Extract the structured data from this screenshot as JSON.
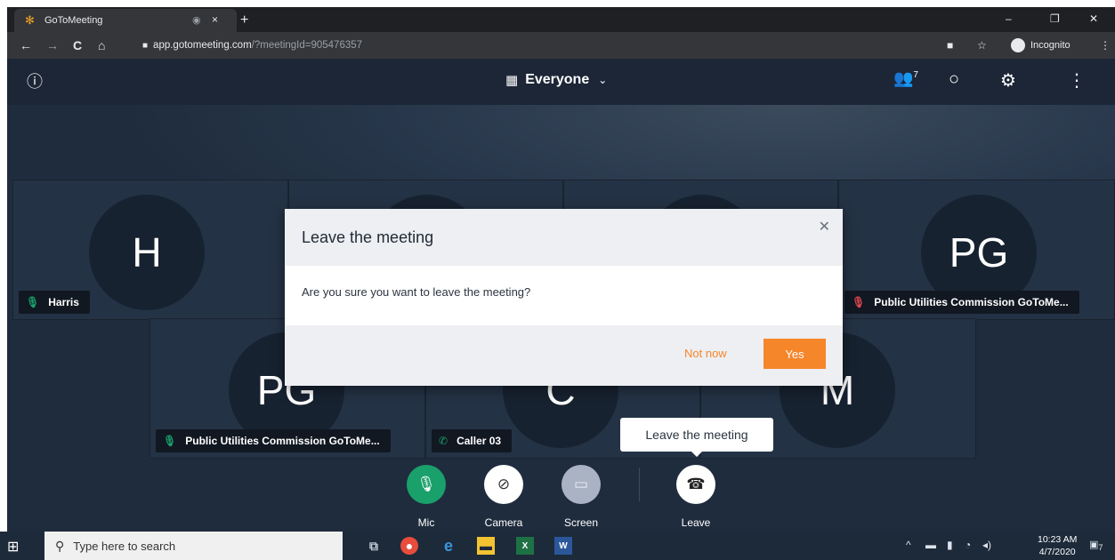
{
  "browser": {
    "tab_title": "GoToMeeting",
    "tab_close": "×",
    "new_tab": "+",
    "url_host": "app.gotomeeting.com",
    "url_rest": "/?meetingId=905476357",
    "incognito_label": "Incognito",
    "back": "←",
    "forward": "→",
    "reload": "C",
    "home": "⌂",
    "window_min": "–",
    "window_restore": "❐",
    "window_close": "✕"
  },
  "app": {
    "view_label": "Everyone",
    "participants_count": "7",
    "tiles": [
      {
        "initials": "H",
        "name": "Harris",
        "icon": "mic-icon"
      },
      {
        "initials": "PG",
        "name": "Public Utilities Commission GoToMe...",
        "icon": "mic-muted-icon"
      },
      {
        "initials": "PG",
        "name": "Public Utilities Commission GoToMe...",
        "icon": "mic-icon"
      },
      {
        "initials": "C",
        "name": "Caller 03",
        "icon": "phone-icon"
      },
      {
        "initials": "M",
        "name": "",
        "icon": ""
      }
    ]
  },
  "modal": {
    "title": "Leave the meeting",
    "message": "Are you sure you want to leave the meeting?",
    "not_now": "Not now",
    "yes": "Yes"
  },
  "tooltip": "Leave the meeting",
  "controls": {
    "mic": "Mic",
    "camera": "Camera",
    "screen": "Screen",
    "leave": "Leave"
  },
  "taskbar": {
    "search_placeholder": "Type here to search",
    "time": "10:23 AM",
    "date": "4/7/2020",
    "notification_count": "7"
  },
  "colors": {
    "accent": "#f6862a",
    "mic_green": "#1aa06b",
    "app_bg": "#1e2a39"
  }
}
